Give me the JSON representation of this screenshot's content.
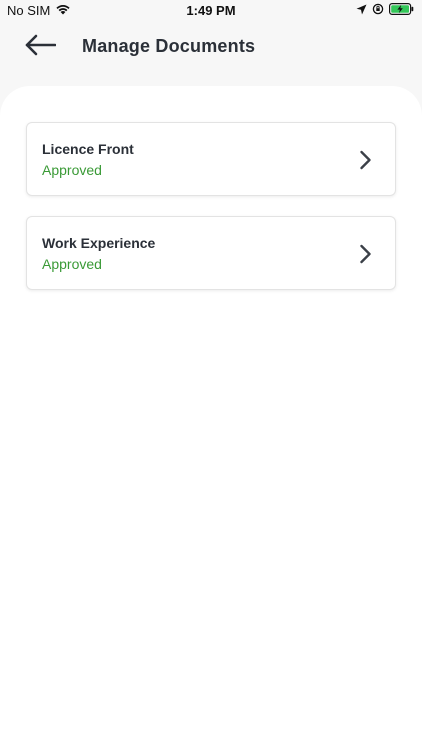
{
  "status_bar": {
    "carrier": "No SIM",
    "time": "1:49 PM",
    "icons": [
      "wifi-icon",
      "location-arrow-icon",
      "orientation-lock-icon",
      "battery-charging-icon"
    ],
    "battery_color": "#34c759"
  },
  "header": {
    "title": "Manage Documents",
    "back_icon": "arrow-left-icon"
  },
  "documents": [
    {
      "title": "Licence Front",
      "status": "Approved"
    },
    {
      "title": "Work Experience",
      "status": "Approved"
    }
  ],
  "colors": {
    "approved": "#3a9a36",
    "title_text": "#2b3038"
  }
}
